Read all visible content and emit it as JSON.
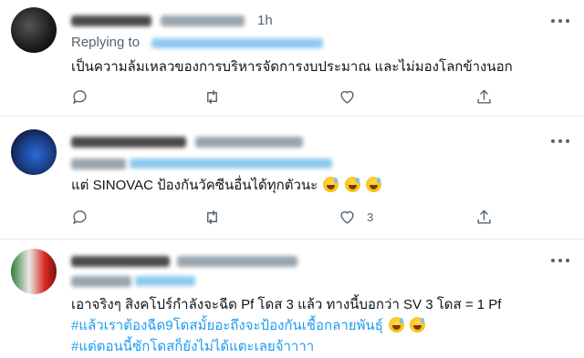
{
  "tweets": [
    {
      "time": "1h",
      "replying_to": "Replying to",
      "text": "เป็นความล้มเหลวของการบริหารจัดการงบประมาณ และไม่มองโลกข้างนอก",
      "reply_count": "",
      "retweet_count": "",
      "like_count": ""
    },
    {
      "text_main": "แต่ SINOVAC ป้องกันวัคซีนอื่นได้ทุกตัวนะ",
      "emoji_names": [
        "grinning-sweat-emoji",
        "grinning-sweat-emoji",
        "grinning-sweat-emoji"
      ],
      "like_count": "3"
    },
    {
      "line1": "เอาจริงๆ สิงคโปร์กำลังจะฉีด Pf โดส 3 แล้ว ทางนี้บอกว่า SV 3 โดส = 1 Pf",
      "line2": "#แล้วเราต้องฉีด9โดสมั้ยอะถึงจะป้องกันเชื้อกลายพันธุ์",
      "line3": "#แต่ตอนนี้ซักโดสก็ยังไม่ได้แตะเลยจ้าาาา"
    }
  ],
  "colors": {
    "hashtag": "#1d9bf0",
    "muted": "#536471",
    "divider": "#e6ecf0"
  }
}
